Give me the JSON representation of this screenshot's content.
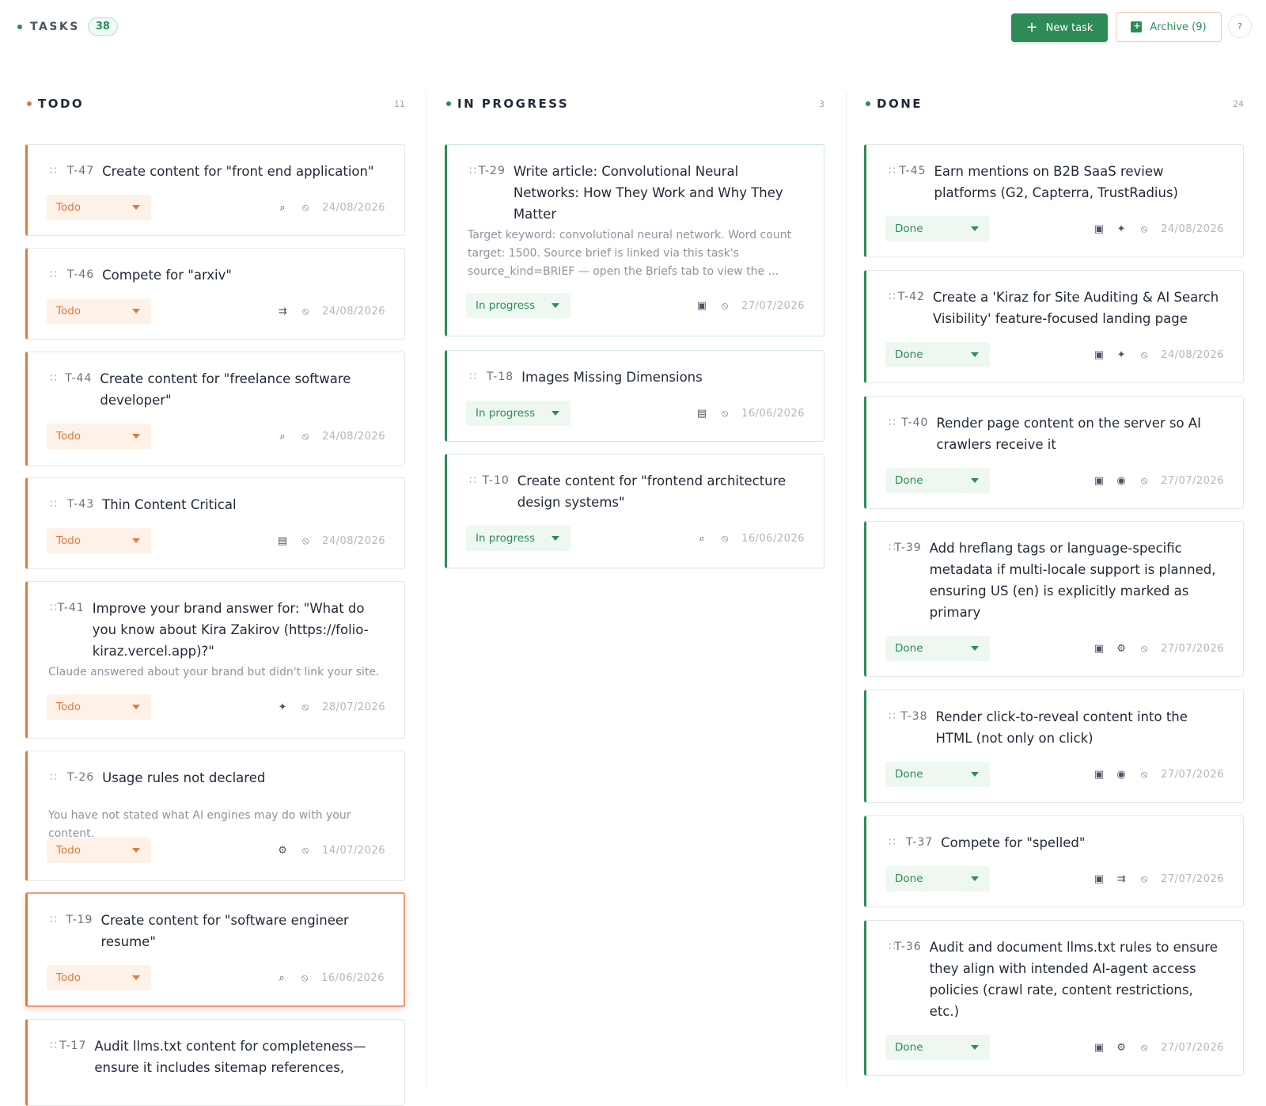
{
  "header": {
    "title": "TASKS",
    "count": "38",
    "new_task_label": "New task",
    "archive_label": "Archive (9)",
    "help_label": "?"
  },
  "columns": [
    {
      "title": "TODO",
      "count": "11",
      "dot_color": "#e07a3f"
    },
    {
      "title": "IN PROGRESS",
      "count": "3",
      "dot_color": "#2e8b57"
    },
    {
      "title": "DONE",
      "count": "24",
      "dot_color": "#2e8b57"
    }
  ],
  "todo": [
    {
      "id": "T-47",
      "title": "Create content for \"front end application\"",
      "status": "Todo",
      "icon": "search-icon",
      "date": "24/08/2026"
    },
    {
      "id": "T-46",
      "title": "Compete for \"arxiv\"",
      "status": "Todo",
      "icon": "compete-icon",
      "date": "24/08/2026"
    },
    {
      "id": "T-44",
      "title": "Create content for \"freelance software developer\"",
      "status": "Todo",
      "icon": "search-icon",
      "date": "24/08/2026"
    },
    {
      "id": "T-43",
      "title": "Thin Content Critical",
      "status": "Todo",
      "icon": "page-icon",
      "date": "24/08/2026"
    },
    {
      "id": "T-41",
      "title": "Improve your brand answer for: \"What do you know about Kira Zakirov (https://folio-kiraz.vercel.app)?\"",
      "desc": "Claude answered about your brand but didn't link your site.",
      "status": "Todo",
      "icon": "sparkle-icon",
      "date": "28/07/2026"
    },
    {
      "id": "T-26",
      "title": "Usage rules not declared",
      "desc": "You have not stated what AI engines may do with your content.",
      "status": "Todo",
      "icon": "bot-icon",
      "date": "14/07/2026"
    },
    {
      "id": "T-19",
      "title": "Create content for \"software engineer resume\"",
      "status": "Todo",
      "icon": "search-icon",
      "date": "16/06/2026"
    },
    {
      "id": "T-17",
      "title": "Audit llms.txt content for completeness—ensure it includes sitemap references,"
    }
  ],
  "progress": [
    {
      "id": "T-29",
      "title": "Write article: Convolutional Neural Networks: How They Work and Why They Matter",
      "desc": "Target keyword: convolutional neural network. Word count target: 1500. Source brief is linked via this task's source_kind=BRIEF — open the Briefs tab to view the ...",
      "status": "In progress",
      "icon": "doc-icon",
      "date": "27/07/2026"
    },
    {
      "id": "T-18",
      "title": "Images Missing Dimensions",
      "status": "In progress",
      "icon": "page-icon",
      "date": "16/06/2026"
    },
    {
      "id": "T-10",
      "title": "Create content for \"frontend architecture design systems\"",
      "status": "In progress",
      "icon": "search-icon",
      "date": "16/06/2026"
    }
  ],
  "done": [
    {
      "id": "T-45",
      "title": "Earn mentions on B2B SaaS review platforms (G2, Capterra, TrustRadius)",
      "status": "Done",
      "icon": "sparkle-icon",
      "date": "24/08/2026"
    },
    {
      "id": "T-42",
      "title": "Create a 'Kiraz for Site Auditing & AI Search Visibility' feature-focused landing page",
      "status": "Done",
      "icon": "sparkle-icon",
      "date": "24/08/2026"
    },
    {
      "id": "T-40",
      "title": "Render page content on the server so AI crawlers receive it",
      "status": "Done",
      "icon": "eye-icon",
      "date": "27/07/2026"
    },
    {
      "id": "T-39",
      "title": "Add hreflang tags or language-specific metadata if multi-locale support is planned, ensuring US (en) is explicitly marked as primary",
      "status": "Done",
      "icon": "bot-icon",
      "date": "27/07/2026"
    },
    {
      "id": "T-38",
      "title": "Render click-to-reveal content into the HTML (not only on click)",
      "status": "Done",
      "icon": "eye-icon",
      "date": "27/07/2026"
    },
    {
      "id": "T-37",
      "title": "Compete for \"spelled\"",
      "status": "Done",
      "icon": "compete-icon",
      "date": "27/07/2026"
    },
    {
      "id": "T-36",
      "title": "Audit and document llms.txt rules to ensure they align with intended AI-agent access policies (crawl rate, content restrictions, etc.)",
      "status": "Done",
      "icon": "bot-icon",
      "date": "27/07/2026"
    }
  ]
}
